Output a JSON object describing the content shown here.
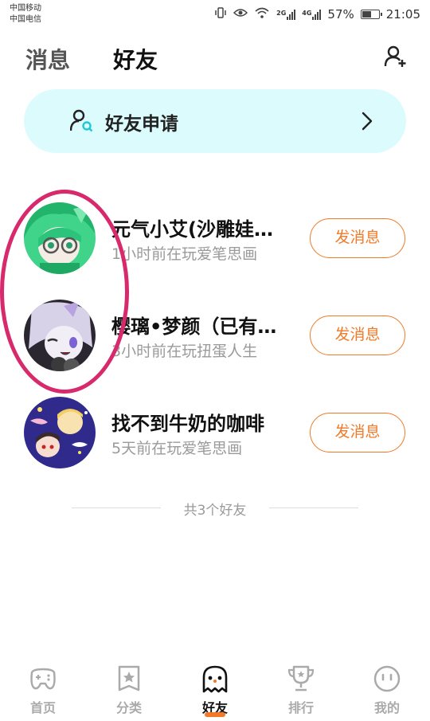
{
  "status_bar": {
    "carrier_1": "中国移动",
    "carrier_2": "中国电信",
    "network_1": "2G",
    "network_2": "4G",
    "battery_percent": "57%",
    "battery_level": 0.57,
    "time": "21:05"
  },
  "header": {
    "tab_messages": "消息",
    "tab_friends": "好友",
    "add_friend_icon": "add-person-icon"
  },
  "friend_request": {
    "label": "好友申请",
    "icon": "person-search-icon"
  },
  "friends": [
    {
      "name": "元气小艾(沙雕娃…",
      "status": "1小时前在玩爱笔思画",
      "button": "发消息"
    },
    {
      "name": "樱璃•梦颜（已有…",
      "status": "3小时前在玩扭蛋人生",
      "button": "发消息"
    },
    {
      "name": "找不到牛奶的咖啡",
      "status": "5天前在玩爱笔思画",
      "button": "发消息"
    }
  ],
  "footer_count": "共3个好友",
  "nav": [
    {
      "label": "首页",
      "icon": "gamepad-icon"
    },
    {
      "label": "分类",
      "icon": "star-card-icon"
    },
    {
      "label": "好友",
      "icon": "ghost-icon",
      "active": true
    },
    {
      "label": "排行",
      "icon": "trophy-icon"
    },
    {
      "label": "我的",
      "icon": "face-icon"
    }
  ],
  "colors": {
    "accent": "#f07a2a",
    "banner_bg": "#dcfbfd",
    "highlight": "#d7296b"
  }
}
